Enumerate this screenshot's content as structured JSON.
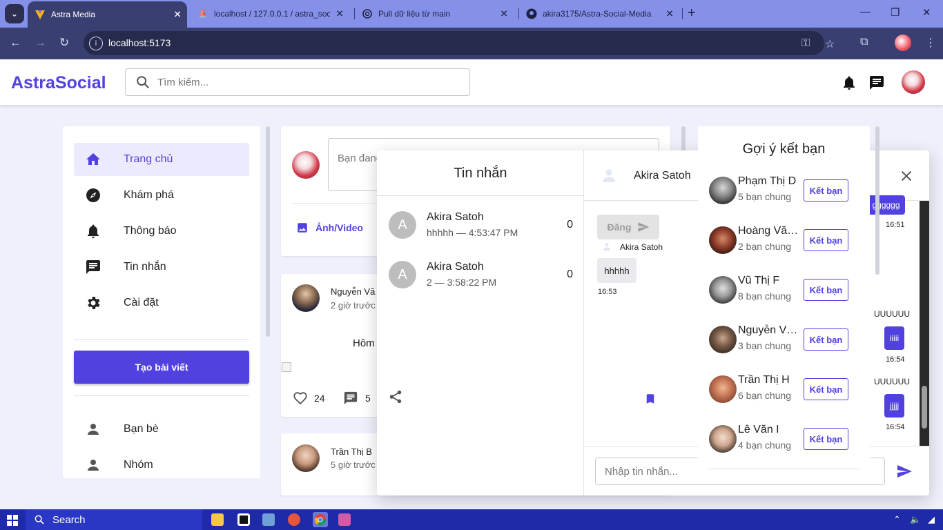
{
  "browser": {
    "tabs": [
      {
        "title": "Astra Media",
        "active": true
      },
      {
        "title": "localhost / 127.0.0.1 / astra_soc",
        "active": false
      },
      {
        "title": "Pull dữ liệu từ main",
        "active": false
      },
      {
        "title": "akira3175/Astra-Social-Media",
        "active": false
      }
    ],
    "url": "localhost:5173"
  },
  "header": {
    "logo": "AstraSocial",
    "search_placeholder": "Tìm kiếm..."
  },
  "sidebar": {
    "items": [
      {
        "label": "Trang chủ",
        "icon": "home-icon",
        "active": true
      },
      {
        "label": "Khám phá",
        "icon": "compass-icon",
        "active": false
      },
      {
        "label": "Thông báo",
        "icon": "bell-icon",
        "active": false
      },
      {
        "label": "Tin nhắn",
        "icon": "chat-icon",
        "active": false
      },
      {
        "label": "Cài đặt",
        "icon": "gear-icon",
        "active": false
      }
    ],
    "create_post": "Tạo bài viết",
    "groups": [
      {
        "label": "Bạn bè",
        "icon": "person-icon"
      },
      {
        "label": "Nhóm",
        "icon": "person-icon"
      }
    ]
  },
  "composer": {
    "placeholder": "Bạn đang nghĩ gì?",
    "media_label": "Ảnh/Video"
  },
  "posts": [
    {
      "author": "Nguyễn Vă",
      "time": "2 giờ trước",
      "content": "Hôm",
      "likes": "24",
      "comments": "5"
    },
    {
      "author": "Trần Thị B",
      "time": "5 giờ trước"
    }
  ],
  "messages": {
    "title": "Tin nhắn",
    "conversations": [
      {
        "initial": "A",
        "name": "Akira Satoh",
        "last": "hhhhh — 4:53:47 PM",
        "count": "0"
      },
      {
        "initial": "A",
        "name": "Akira Satoh",
        "last": "2 — 3:58:22 PM",
        "count": "0"
      }
    ],
    "chat": {
      "contact": "Akira Satoh",
      "post_button": "Đăng",
      "sender_label": "Akira Satoh",
      "incoming": {
        "text": "hhhhh",
        "time": "16:53"
      },
      "outgoing": [
        {
          "text": "gggggg",
          "time": "16:51"
        },
        {
          "text": "UUUUUU"
        },
        {
          "text": "iiiii",
          "time": "16:54"
        },
        {
          "text": "UUUUUU"
        },
        {
          "text": "jjjjj",
          "time": "16:54"
        }
      ],
      "input_placeholder": "Nhập tin nhắn..."
    }
  },
  "suggestions": {
    "title": "Gợi ý kết bạn",
    "button_label": "Kết bạn",
    "people": [
      {
        "name": "Phạm Thị D",
        "mutual": "5 bạn chung"
      },
      {
        "name": "Hoàng Văn E",
        "mutual": "2 bạn chung"
      },
      {
        "name": "Vũ Thị F",
        "mutual": "8 bạn chung"
      },
      {
        "name": "Nguyễn Văn G",
        "mutual": "3 bạn chung"
      },
      {
        "name": "Trần Thị H",
        "mutual": "6 bạn chung"
      },
      {
        "name": "Lê Văn I",
        "mutual": "4 bạn chung"
      }
    ]
  },
  "taskbar": {
    "search_label": "Search"
  },
  "colors": {
    "accent": "#5142e0",
    "tab_bar": "#8590e9",
    "taskbar": "#1e2aa8"
  }
}
